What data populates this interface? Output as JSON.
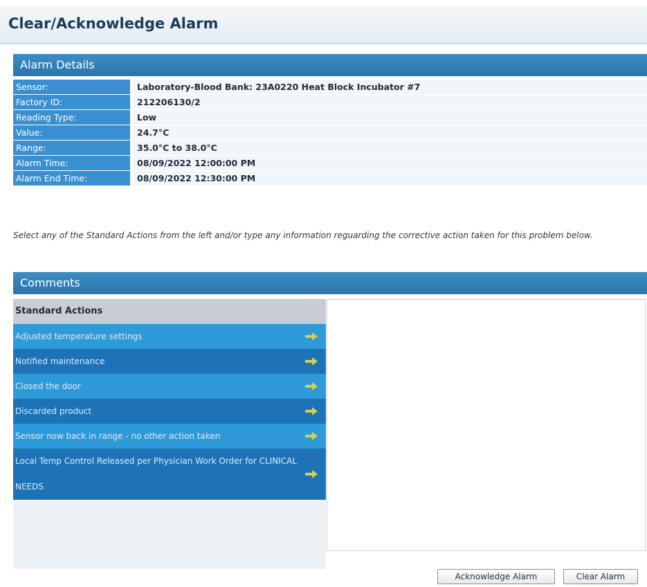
{
  "page": {
    "title": "Clear/Acknowledge Alarm"
  },
  "alarm_details": {
    "header": "Alarm Details",
    "rows": [
      {
        "label": "Sensor:",
        "value": "Laboratory-Blood Bank: 23A0220 Heat Block Incubator #7"
      },
      {
        "label": "Factory ID:",
        "value": "212206130/2"
      },
      {
        "label": "Reading Type:",
        "value": "Low"
      },
      {
        "label": "Value:",
        "value": "24.7°C"
      },
      {
        "label": "Range:",
        "value": "35.0°C to 38.0°C"
      },
      {
        "label": "Alarm Time:",
        "value": "08/09/2022 12:00:00 PM"
      },
      {
        "label": "Alarm End Time:",
        "value": "08/09/2022 12:30:00 PM"
      }
    ]
  },
  "instructions": "Select any of the Standard Actions from the left and/or type any information reguarding the corrective action taken for this problem below.",
  "comments": {
    "header": "Comments",
    "standard_actions_header": "Standard Actions",
    "actions": [
      {
        "label": "Adjusted temperature settings",
        "icon": "arrow-right-icon"
      },
      {
        "label": "Notified maintenance",
        "icon": "arrow-right-icon"
      },
      {
        "label": "Closed the door",
        "icon": "arrow-right-icon"
      },
      {
        "label": "Discarded product",
        "icon": "arrow-right-icon"
      },
      {
        "label": "Sensor now back in range - no other action taken",
        "icon": "arrow-right-icon"
      },
      {
        "label": "Local Temp Control Released per Physician Work Order for CLINICAL NEEDS",
        "icon": "arrow-right-icon"
      }
    ],
    "comment_text": ""
  },
  "buttons": {
    "acknowledge": "Acknowledge Alarm",
    "clear": "Clear Alarm"
  },
  "colors": {
    "header_blue": "#2a74a9",
    "label_blue": "#3a8fd0",
    "action_light": "#2f9ad9",
    "action_dark": "#1e73b7",
    "arrow_yellow": "#d8cf4a"
  }
}
